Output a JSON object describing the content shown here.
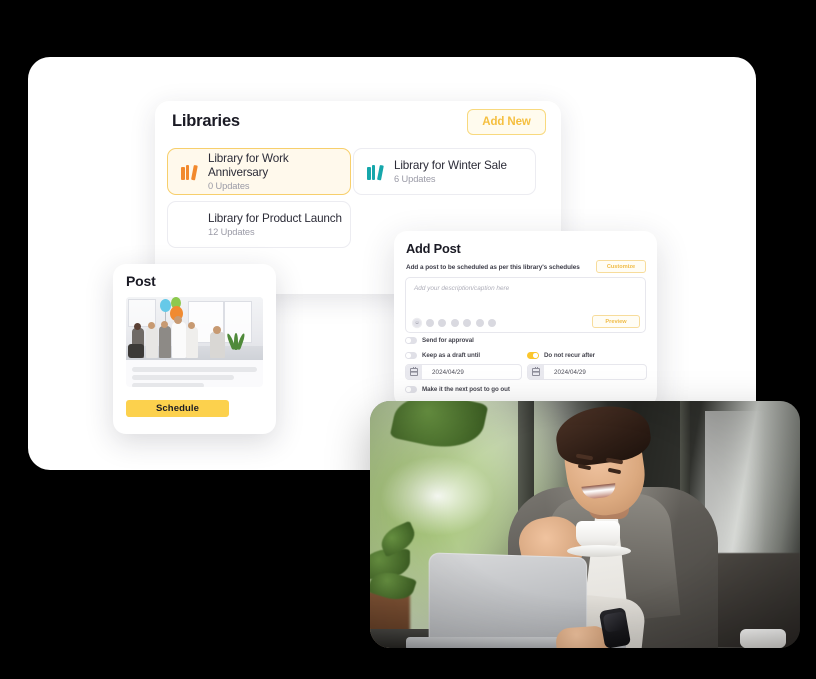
{
  "libraries_panel": {
    "title": "Libraries",
    "add_new_label": "Add New",
    "cards": [
      {
        "name": "Library for Work Anniversary",
        "updates": "0 Updates",
        "icon": "books-icon",
        "color": "#f2892d",
        "selected": true
      },
      {
        "name": "Library for Winter Sale",
        "updates": "6 Updates",
        "icon": "books-icon",
        "color": "#16a7ab",
        "selected": false
      },
      {
        "name": "Library for Product Launch",
        "updates": "12 Updates",
        "icon": "books-icon",
        "color": "#b martial",
        "selected": false
      }
    ]
  },
  "post_card": {
    "title": "Post",
    "schedule_label": "Schedule",
    "image_alt": "office-celebration-photo"
  },
  "add_post_panel": {
    "title": "Add Post",
    "subtitle": "Add a post to be scheduled as per this library's schedules",
    "customize_label": "Customize",
    "editor_placeholder": "Add your description/caption here",
    "preview_label": "Preview",
    "toolbar_icons": [
      "emoji-icon",
      "hashtag-icon",
      "link-icon",
      "image-icon",
      "clock-icon",
      "tag-icon",
      "settings-icon"
    ],
    "toggles": [
      {
        "label": "Send for approval",
        "on": false
      },
      {
        "label": "Keep as a draft until",
        "on": false
      },
      {
        "label": "Do not recur after",
        "on": true
      },
      {
        "label": "Make it the next post to go out",
        "on": false
      }
    ],
    "dates": [
      {
        "value": "2024/04/29",
        "icon": "calendar-icon"
      },
      {
        "value": "2024/04/29",
        "icon": "calendar-icon"
      }
    ]
  },
  "photo": {
    "alt": "man-smiling-with-coffee-and-laptop-in-cafe"
  },
  "colors": {
    "accent_yellow": "#fbc62c",
    "schedule_yellow": "#fcd14d",
    "selected_bg": "#fff9ec",
    "selected_border": "#f7cf6c",
    "text_dark": "#1a1a24",
    "text_muted": "#9a9aa6"
  }
}
